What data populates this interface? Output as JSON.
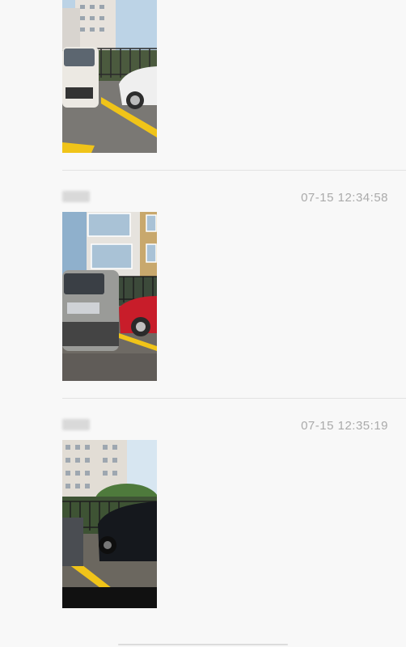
{
  "moments": [
    {
      "author": "",
      "time": "",
      "photo": {
        "description_icon": "parked-car-photo-icon"
      }
    },
    {
      "author": "",
      "time": "07-15 12:34:58",
      "photo": {
        "description_icon": "parked-car-photo-icon"
      }
    },
    {
      "author": "",
      "time": "07-15 12:35:19",
      "photo": {
        "description_icon": "parked-car-photo-icon"
      }
    }
  ],
  "colors": {
    "background": "#f8f8f8",
    "divider": "#e2e2e2",
    "timestamp": "#aaaaaa",
    "parking_line": "#f0c419"
  }
}
